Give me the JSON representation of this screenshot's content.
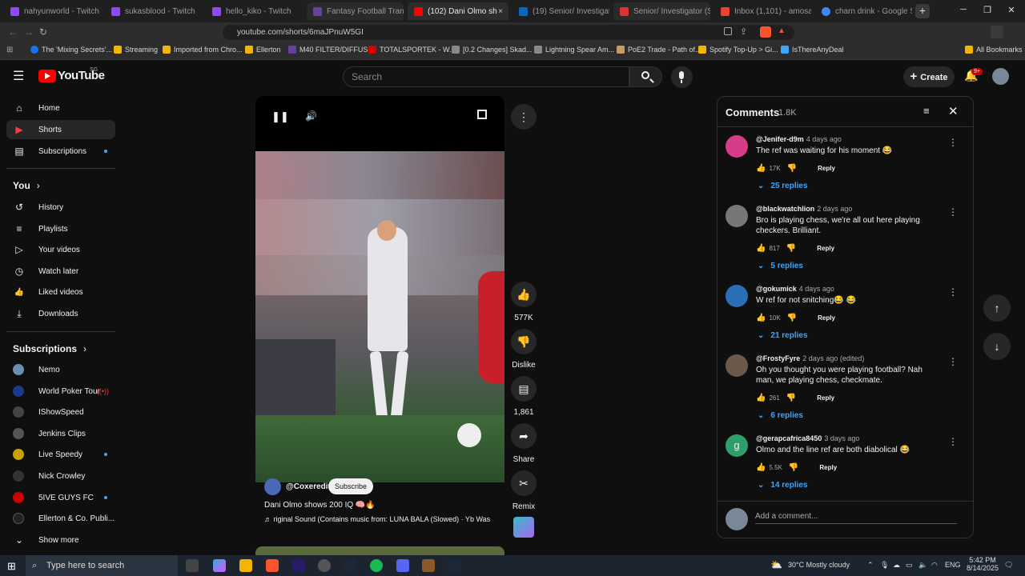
{
  "browser": {
    "tabs": [
      {
        "label": "nahyunworld - Twitch",
        "color": "#9146ff"
      },
      {
        "label": "sukasblood - Twitch",
        "color": "#9146ff"
      },
      {
        "label": "hello_kiko - Twitch",
        "color": "#9146ff"
      },
      {
        "label": "Fantasy Football Transfers",
        "color": "#6b3fa0"
      },
      {
        "label": "(102) Dani Olmo sh",
        "color": "#ff0000"
      },
      {
        "label": "(19) Senior/ Investigator (",
        "color": "#0a66c2"
      },
      {
        "label": "Senior/ Investigator (Supe",
        "color": "#d33"
      },
      {
        "label": "Inbox (1,101) - amosama",
        "color": "#ea4335"
      },
      {
        "label": "charn drink - Google Sear",
        "color": "#4285f4"
      }
    ],
    "active_tab_close": "×",
    "new_tab": "+",
    "url": "youtube.com/shorts/6maJPnuW5GI",
    "bookmarks": [
      {
        "label": "The 'Mixing Secrets'...",
        "color": "#1a73e8"
      },
      {
        "label": "Streaming",
        "color": "#f4b400"
      },
      {
        "label": "Imported from Chro...",
        "color": "#f4b400"
      },
      {
        "label": "Ellerton",
        "color": "#f4b400"
      },
      {
        "label": "M40 FILTER/DIFFUS...",
        "color": "#6b3fa0"
      },
      {
        "label": "TOTALSPORTEK - W...",
        "color": "#d00"
      },
      {
        "label": "[0.2 Changes] Skad...",
        "color": "#888"
      },
      {
        "label": "Lightning Spear Am...",
        "color": "#888"
      },
      {
        "label": "PoE2 Trade - Path of...",
        "color": "#c96"
      },
      {
        "label": "Spotify Top-Up > Gi...",
        "color": "#f4b400"
      },
      {
        "label": "IsThereAnyDeal",
        "color": "#3ea6ff"
      }
    ],
    "all_bookmarks": "All Bookmarks"
  },
  "youtube": {
    "logo": "YouTube",
    "region": "SG",
    "search_placeholder": "Search",
    "create_label": "Create",
    "notif_badge": "9+"
  },
  "sidebar": {
    "main": [
      {
        "label": "Home",
        "icon": "⌂"
      },
      {
        "label": "Shorts",
        "icon": "▶"
      },
      {
        "label": "Subscriptions",
        "icon": "▤"
      }
    ],
    "you_title": "You",
    "you": [
      {
        "label": "History",
        "icon": "↺"
      },
      {
        "label": "Playlists",
        "icon": "≡"
      },
      {
        "label": "Your videos",
        "icon": "▷"
      },
      {
        "label": "Watch later",
        "icon": "◷"
      },
      {
        "label": "Liked videos",
        "icon": "👍"
      },
      {
        "label": "Downloads",
        "icon": "⤓"
      }
    ],
    "subs_title": "Subscriptions",
    "subs": [
      {
        "label": "Nemo",
        "color": "#6a8fb0"
      },
      {
        "label": "World Poker Tour",
        "color": "#1a3a8a"
      },
      {
        "label": "IShowSpeed",
        "color": "#444"
      },
      {
        "label": "Jenkins Clips",
        "color": "#555"
      },
      {
        "label": "Live Speedy",
        "color": "#c8a000"
      },
      {
        "label": "Nick Crowley",
        "color": "#333"
      },
      {
        "label": "5IVE GUYS FC",
        "color": "#c00"
      },
      {
        "label": "Ellerton & Co. Publi...",
        "color": "#222"
      }
    ],
    "show_more": "Show more"
  },
  "short": {
    "channel": "@Coxeredit",
    "subscribe": "Subscribe",
    "title": "Dani Olmo shows 200 IQ 🧠🔥",
    "sound": "♬ riginal Sound (Contains music from: LUNA BALA (Slowed) · Yb Was",
    "likes": "577K",
    "dislike": "Dislike",
    "comments": "1,861",
    "share": "Share",
    "remix": "Remix"
  },
  "comments_panel": {
    "title": "Comments",
    "count": "1.8K",
    "add_placeholder": "Add a comment...",
    "reply_label": "Reply",
    "items": [
      {
        "handle": "@Jenifer-d9m",
        "time": "4 days ago",
        "text": "The ref was waiting for his moment 😂",
        "likes": "17K",
        "replies": "25 replies",
        "color": "#d63c8a"
      },
      {
        "handle": "@blackwatchlion",
        "time": "2 days ago",
        "text": "Bro is playing chess, we're all out here playing checkers.  Brilliant.",
        "likes": "817",
        "replies": "5 replies",
        "color": "#777"
      },
      {
        "handle": "@gokumick",
        "time": "4 days ago",
        "text": "W ref for not snitching😂 😂",
        "likes": "10K",
        "replies": "21 replies",
        "color": "#2a6fb5"
      },
      {
        "handle": "@FrostyFyre",
        "time": "2 days ago (edited)",
        "text": "Oh you thought you were playing football? Nah man, we playing chess, checkmate.",
        "likes": "261",
        "replies": "6 replies",
        "color": "#6b5a4a"
      },
      {
        "handle": "@gerapcafrica8450",
        "time": "3 days ago",
        "text": "Olmo and the line ref are both diabolical 😂",
        "likes": "5.5K",
        "replies": "14 replies",
        "color": "#2e9e6a",
        "initial": "g"
      }
    ]
  },
  "taskbar": {
    "search_placeholder": "Type here to search",
    "weather": "30°C  Mostly cloudy",
    "lang": "ENG",
    "time": "5:42 PM",
    "date": "8/14/2025"
  }
}
